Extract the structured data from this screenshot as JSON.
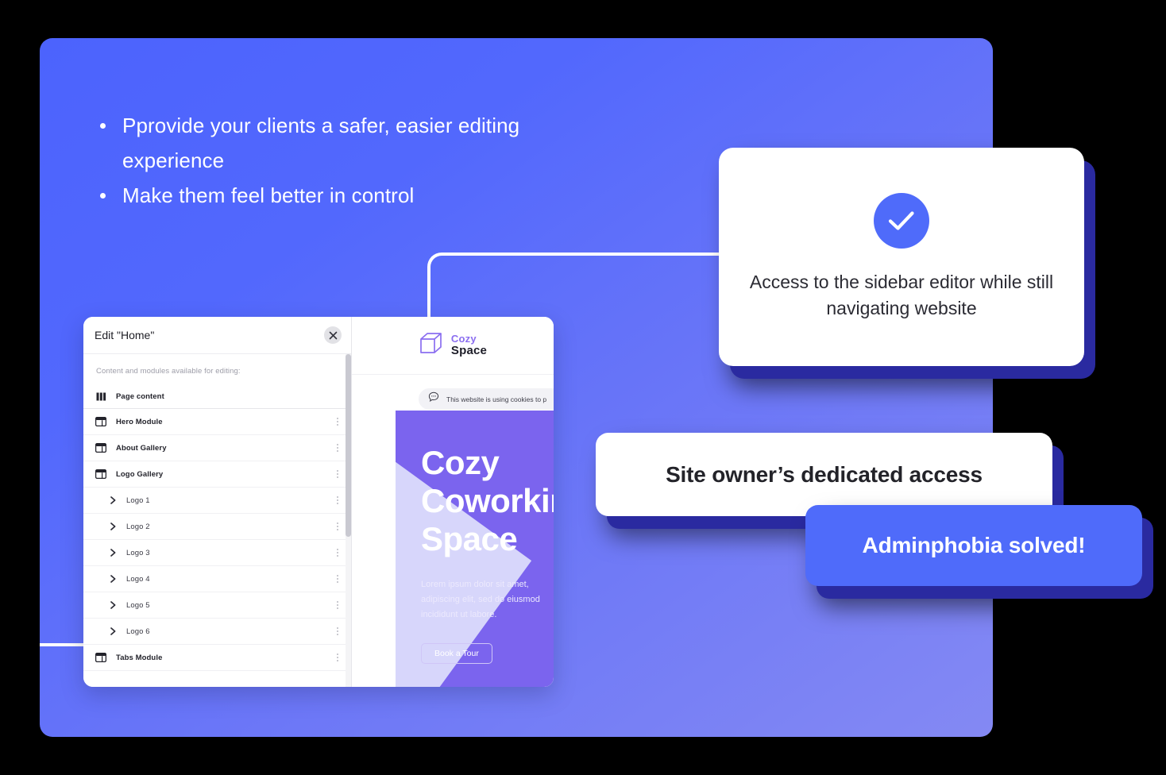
{
  "hero": {
    "bullets": [
      "Pprovide your clients a safer, easier editing experience",
      "Make them feel better in control"
    ]
  },
  "editor": {
    "title": "Edit \"Home\"",
    "close_icon": "close-icon",
    "subtitle": "Content and modules available for editing:",
    "page_content_label": "Page content",
    "page_content_icon": "columns-icon",
    "modules": [
      {
        "label": "Hero Module",
        "icon": "module-icon",
        "child": false
      },
      {
        "label": "About Gallery",
        "icon": "module-icon",
        "child": false
      },
      {
        "label": "Logo Gallery",
        "icon": "module-icon",
        "child": false
      },
      {
        "label": "Logo 1",
        "icon": "chevron-right-icon",
        "child": true
      },
      {
        "label": "Logo 2",
        "icon": "chevron-right-icon",
        "child": true
      },
      {
        "label": "Logo 3",
        "icon": "chevron-right-icon",
        "child": true
      },
      {
        "label": "Logo 4",
        "icon": "chevron-right-icon",
        "child": true
      },
      {
        "label": "Logo 5",
        "icon": "chevron-right-icon",
        "child": true
      },
      {
        "label": "Logo 6",
        "icon": "chevron-right-icon",
        "child": true
      },
      {
        "label": "Tabs Module",
        "icon": "module-icon",
        "child": false
      }
    ]
  },
  "preview": {
    "brand_primary": "Cozy",
    "brand_secondary": "Space",
    "logo_icon": "cube-icon",
    "cookie_icon": "chat-bubble-icon",
    "cookie_text": "This website is using cookies to p",
    "hero_title_lines": [
      "Cozy",
      "Coworking",
      "Space"
    ],
    "hero_body_lines": [
      "Lorem ipsum dolor sit amet,",
      "adipiscing elit, sed do eiusmod",
      "incididunt ut labore."
    ],
    "hero_button": "Book a Tour"
  },
  "callouts": {
    "check_icon": "checkmark-icon",
    "check_card_text": "Access to the sidebar editor while still navigating website",
    "owner_card_text": "Site owner’s dedicated access",
    "admin_card_text": "Adminphobia solved!"
  },
  "colors": {
    "panel_start": "#4c63fd",
    "panel_end": "#8489f3",
    "accent_blue": "#4f6bfa",
    "shadow_indigo": "#2a2aa0",
    "hero_purple": "#7b64ee",
    "brand_purple": "#8b6ef0"
  }
}
